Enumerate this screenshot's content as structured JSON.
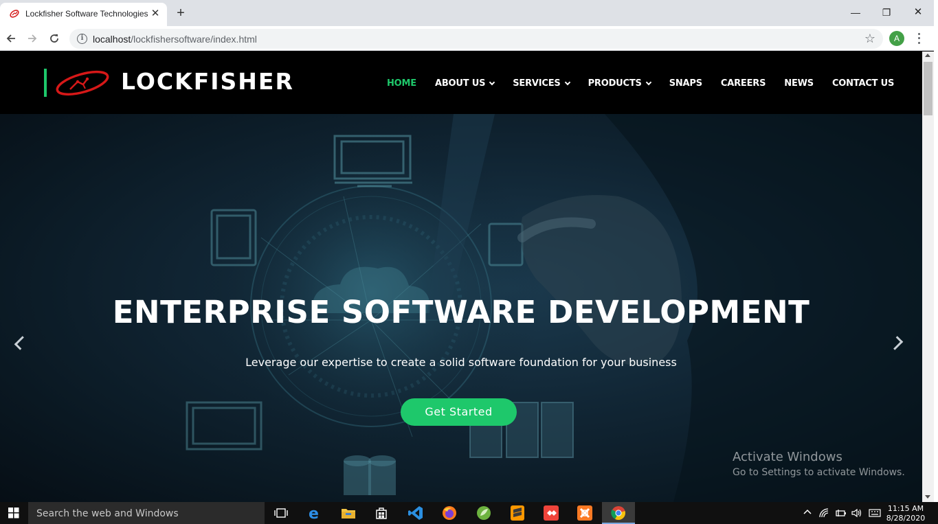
{
  "browser": {
    "tab_title": "Lockfisher Software Technologies",
    "url_host": "localhost",
    "url_path": "/lockfishersoftware/index.html",
    "profile_initial": "A",
    "new_tab_glyph": "+",
    "close_tab_glyph": "✕",
    "window_controls": {
      "minimize": "—",
      "maximize": "❐",
      "close": "✕"
    },
    "info_glyph": "i",
    "star_glyph": "☆"
  },
  "site": {
    "brand": "LOCKFISHER",
    "accent_color": "#1ec86b",
    "nav": [
      {
        "label": "HOME",
        "active": true,
        "dropdown": false
      },
      {
        "label": "ABOUT US",
        "active": false,
        "dropdown": true
      },
      {
        "label": "SERVICES",
        "active": false,
        "dropdown": true
      },
      {
        "label": "PRODUCTS",
        "active": false,
        "dropdown": true
      },
      {
        "label": "SNAPS",
        "active": false,
        "dropdown": false
      },
      {
        "label": "CAREERS",
        "active": false,
        "dropdown": false
      },
      {
        "label": "NEWS",
        "active": false,
        "dropdown": false
      },
      {
        "label": "CONTACT US",
        "active": false,
        "dropdown": false
      }
    ],
    "hero": {
      "title": "ENTERPRISE SOFTWARE DEVELOPMENT",
      "subtitle": "Leverage our expertise to create a solid software foundation for your business",
      "cta": "Get Started"
    }
  },
  "watermark": {
    "line1": "Activate Windows",
    "line2": "Go to Settings to activate Windows."
  },
  "taskbar": {
    "search_placeholder": "Search the web and Windows",
    "apps": [
      "task-view-icon",
      "edge-icon",
      "file-explorer-icon",
      "store-icon",
      "vscode-icon",
      "firefox-icon",
      "spring-tool-icon",
      "sublime-text-icon",
      "anydesk-icon",
      "xampp-icon",
      "chrome-icon"
    ],
    "time": "11:15 AM",
    "date": "8/28/2020"
  }
}
